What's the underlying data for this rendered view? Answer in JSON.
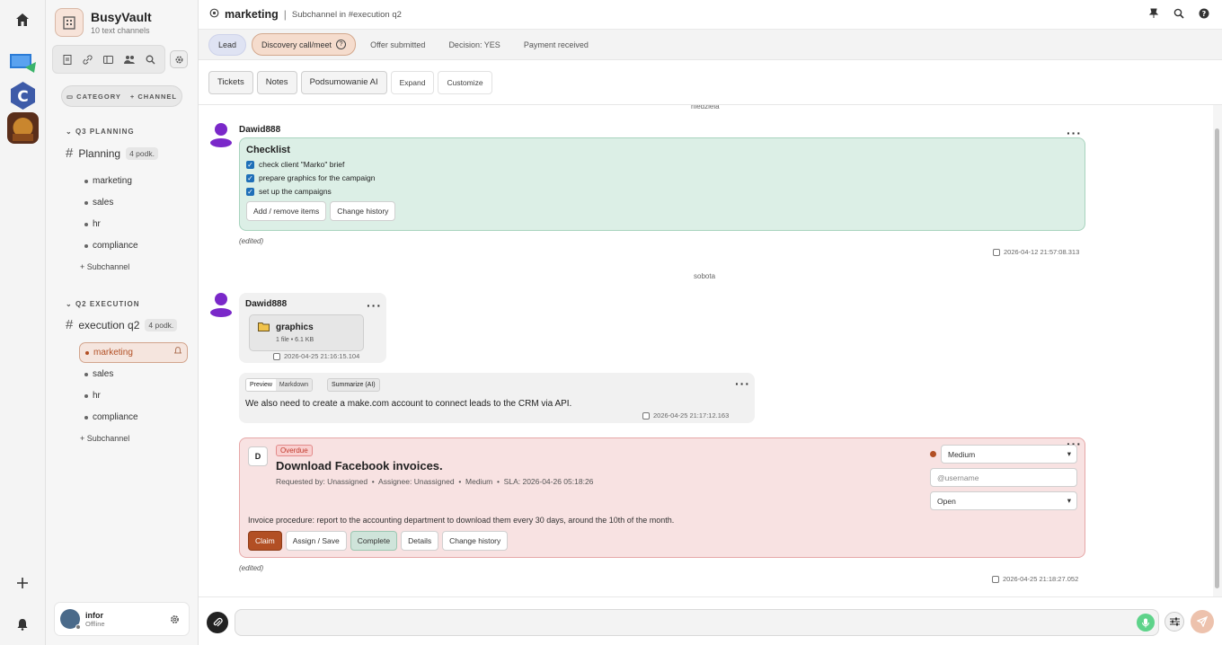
{
  "server": {
    "name": "BusyVault",
    "subtitle": "10 text channels"
  },
  "sidebar": {
    "category_btn": "CATEGORY",
    "channel_btn": "CHANNEL",
    "groups": [
      {
        "title": "Q3 PLANNING",
        "channel": "Planning",
        "count": "4 podk.",
        "subs": [
          "marketing",
          "sales",
          "hr",
          "compliance"
        ],
        "add_label": "Subchannel"
      },
      {
        "title": "Q2 EXECUTION",
        "channel": "execution q2",
        "count": "4 podk.",
        "subs": [
          "marketing",
          "sales",
          "hr",
          "compliance"
        ],
        "add_label": "Subchannel"
      }
    ],
    "user": {
      "name": "infor",
      "status": "Offline"
    }
  },
  "header": {
    "channel": "marketing",
    "crumb": "Subchannel in #execution q2"
  },
  "stages": [
    "Lead",
    "Discovery call/meet",
    "Offer submitted",
    "Decision: YES",
    "Payment received"
  ],
  "tabs": [
    "Tickets",
    "Notes",
    "Podsumowanie AI",
    "Expand",
    "Customize"
  ],
  "messages": {
    "day1": "niedziela",
    "author1": "Dawid888",
    "checklist": {
      "title": "Checklist",
      "items": [
        "check client \"Marko\" brief",
        "prepare graphics for the campaign",
        "set up the campaigns"
      ],
      "btn_add": "Add / remove items",
      "btn_history": "Change history"
    },
    "edited": "(edited)",
    "ts1": "2026-04-12 21:57:08.313",
    "day2": "sobota",
    "author2": "Dawid888",
    "file": {
      "name": "graphics",
      "meta": "1 file • 6.1 KB",
      "ts": "2026-04-25 21:16:15.104"
    },
    "text": {
      "seg_preview": "Preview",
      "seg_markdown": "Markdown",
      "summarize": "Summarize (AI)",
      "body": "We also need to create a make.com account to connect leads to the CRM via API.",
      "ts": "2026-04-25 21:17:12.163"
    },
    "ticket": {
      "avatar_letter": "D",
      "badge": "Overdue",
      "title": "Download Facebook invoices.",
      "meta": "Requested by: Unassigned  •  Assignee: Unassigned  •  Medium  •  SLA: 2026-04-26 05:18:26",
      "desc": "Invoice procedure: report to the accounting department to download them every 30 days, around the 10th of the month.",
      "priority": "Medium",
      "assignee_placeholder": "@username",
      "status": "Open",
      "btn_claim": "Claim",
      "btn_assign": "Assign / Save",
      "btn_complete": "Complete",
      "btn_details": "Details",
      "btn_history": "Change history",
      "ts": "2026-04-25 21:18:27.052"
    }
  },
  "colors": {
    "accent": "#b24f24",
    "checklist_bg": "#dcefe6",
    "ticket_bg": "#f8e2e2",
    "mic": "#5ed38a"
  }
}
